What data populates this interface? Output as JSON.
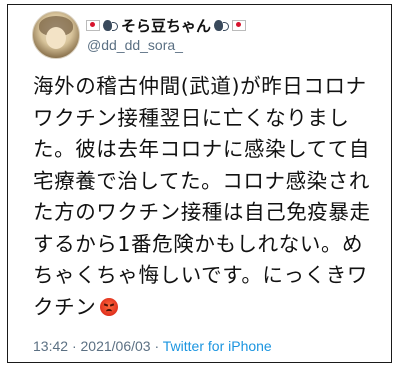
{
  "user": {
    "display_name": "そら豆ちゃん",
    "handle": "@dd_dd_sora_",
    "flag_icon": "japan-flag-icon",
    "speak_icon": "speaking-head-icon"
  },
  "tweet": {
    "lines": [
      "海外の稽古仲間(武道)が昨日コロナ",
      "ワクチン接種翌日に亡くなりまし",
      "た。彼は去年コロナに感染してて自",
      "宅療養で治してた。コロナ感染され",
      "た方のワクチン接種は自己免疫暴走",
      "するから1番危険かもしれない。め",
      "ちゃくちゃ悔しいです。にっくきワ",
      "クチン"
    ],
    "emoji": "angry-face-icon"
  },
  "meta": {
    "time": "13:42",
    "separator": "·",
    "date": "2021/06/03",
    "source": "Twitter for iPhone"
  },
  "colors": {
    "text": "#111111",
    "muted": "#5b7083",
    "link": "#1b95e0",
    "flag_red": "#d7142d"
  }
}
